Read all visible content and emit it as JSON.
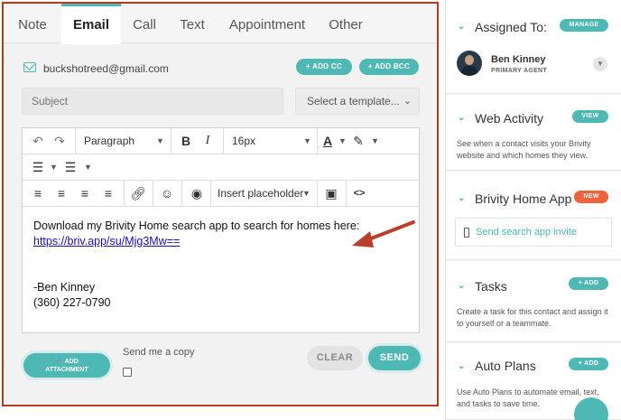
{
  "tabs": [
    {
      "label": "Note"
    },
    {
      "label": "Email"
    },
    {
      "label": "Call"
    },
    {
      "label": "Text"
    },
    {
      "label": "Appointment"
    },
    {
      "label": "Other"
    }
  ],
  "email": {
    "address": "buckshotreed@gmail.com",
    "add_cc": "+ ADD CC",
    "add_bcc": "+ ADD BCC",
    "subject_placeholder": "Subject",
    "template_placeholder": "Select a template..."
  },
  "toolbar": {
    "paragraph": "Paragraph",
    "font_size": "16px",
    "placeholder": "Insert placeholder",
    "bold": "B",
    "italic": "I",
    "text_color": "A",
    "code": "<>"
  },
  "body": {
    "line1": "Download my Brivity Home search app to search for homes here:",
    "link": "https://briv.app/su/Mjg3Mw==",
    "sig_name": "-Ben Kinney",
    "sig_phone": " (360) 227-0790"
  },
  "footer": {
    "attach_label_1": "📎 ADD",
    "attach_label_2": "ATTACHMENT",
    "send_copy": "Send me a copy",
    "clear": "CLEAR",
    "send": "SEND"
  },
  "sidebar": {
    "assigned": {
      "title": "Assigned To:",
      "action": "MANAGE",
      "agent_name": "Ben Kinney",
      "agent_role": "PRIMARY AGENT"
    },
    "web_activity": {
      "title": "Web Activity",
      "action": "VIEW",
      "desc": "See when a contact visits your Brivity website and which homes they view."
    },
    "home_app": {
      "title": "Brivity Home App",
      "badge": "NEW",
      "invite": "Send search app invite"
    },
    "tasks": {
      "title": "Tasks",
      "action": "+ ADD",
      "desc": "Create a task for this contact and assign it to yourself or a teammate."
    },
    "auto_plans": {
      "title": "Auto Plans",
      "action": "+ ADD",
      "desc": "Use Auto Plans to automate email, text, and tasks to save time."
    }
  },
  "colors": {
    "accent": "#4db8b4",
    "border_highlight": "#b03a22",
    "new_badge": "#f0623c",
    "arrow": "#b8402a"
  }
}
